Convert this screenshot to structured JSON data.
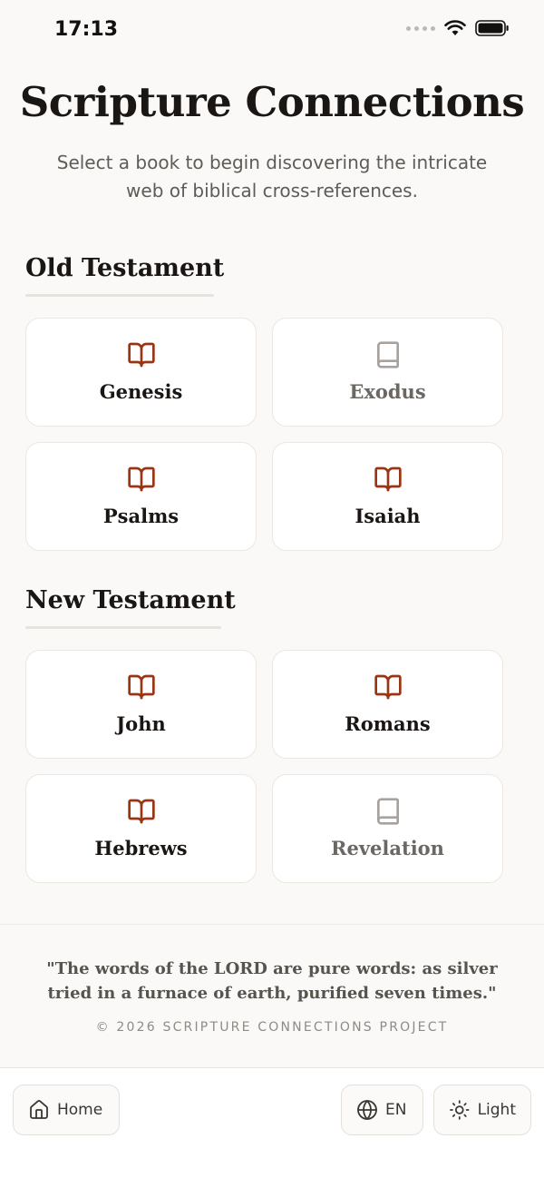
{
  "status": {
    "time": "17:13"
  },
  "hero": {
    "title": "Scripture Connections",
    "subtitle": "Select a book to begin discovering the intricate web of biblical cross-references."
  },
  "old_testament": {
    "heading": "Old Testament",
    "books": [
      {
        "name": "Genesis",
        "icon": "open-book-icon",
        "enabled": true
      },
      {
        "name": "Exodus",
        "icon": "closed-book-icon",
        "enabled": false
      },
      {
        "name": "Psalms",
        "icon": "open-book-icon",
        "enabled": true
      },
      {
        "name": "Isaiah",
        "icon": "open-book-icon",
        "enabled": true
      }
    ]
  },
  "new_testament": {
    "heading": "New Testament",
    "books": [
      {
        "name": "John",
        "icon": "open-book-icon",
        "enabled": true
      },
      {
        "name": "Romans",
        "icon": "open-book-icon",
        "enabled": true
      },
      {
        "name": "Hebrews",
        "icon": "open-book-icon",
        "enabled": true
      },
      {
        "name": "Revelation",
        "icon": "closed-book-icon",
        "enabled": false
      }
    ]
  },
  "footer": {
    "quote": "\"The words of the LORD are pure words: as silver tried in a furnace of earth, purified seven times.\"",
    "copyright": "© 2026 SCRIPTURE CONNECTIONS PROJECT"
  },
  "bottom_bar": {
    "home_label": "Home",
    "language_label": "EN",
    "theme_label": "Light"
  },
  "colors": {
    "accent": "#9a3412",
    "disabled_icon": "#a8a29e",
    "background": "#faf9f7"
  }
}
